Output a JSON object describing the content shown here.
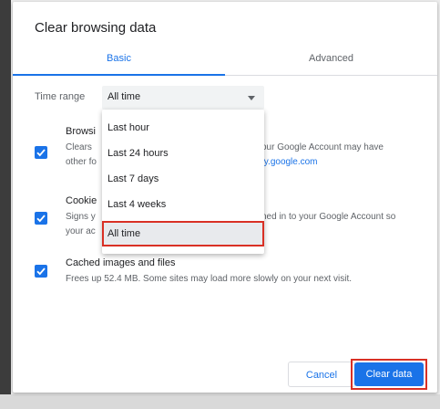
{
  "dialog": {
    "title": "Clear browsing data",
    "tabs": [
      {
        "label": "Basic",
        "active": true
      },
      {
        "label": "Advanced",
        "active": false
      }
    ]
  },
  "time_range": {
    "label": "Time range",
    "selected": "All time",
    "options": [
      "Last hour",
      "Last 24 hours",
      "Last 7 days",
      "Last 4 weeks",
      "All time"
    ]
  },
  "items": [
    {
      "title": "Browsi",
      "desc_left": "Clears",
      "desc_left_2": "other fo",
      "desc_right": "our Google Account may have",
      "desc_link": "fy.google.com",
      "checked": true
    },
    {
      "title": "Cookie",
      "desc_left": "Signs y",
      "desc_left_2": "your ac",
      "desc_right": "ned in to your Google Account so",
      "checked": true
    },
    {
      "title": "Cached images and files",
      "desc": "Frees up 52.4 MB. Some sites may load more slowly on your next visit.",
      "checked": true
    }
  ],
  "buttons": {
    "cancel": "Cancel",
    "clear": "Clear data"
  },
  "colors": {
    "accent": "#1a73e8",
    "highlight": "#d93025"
  }
}
